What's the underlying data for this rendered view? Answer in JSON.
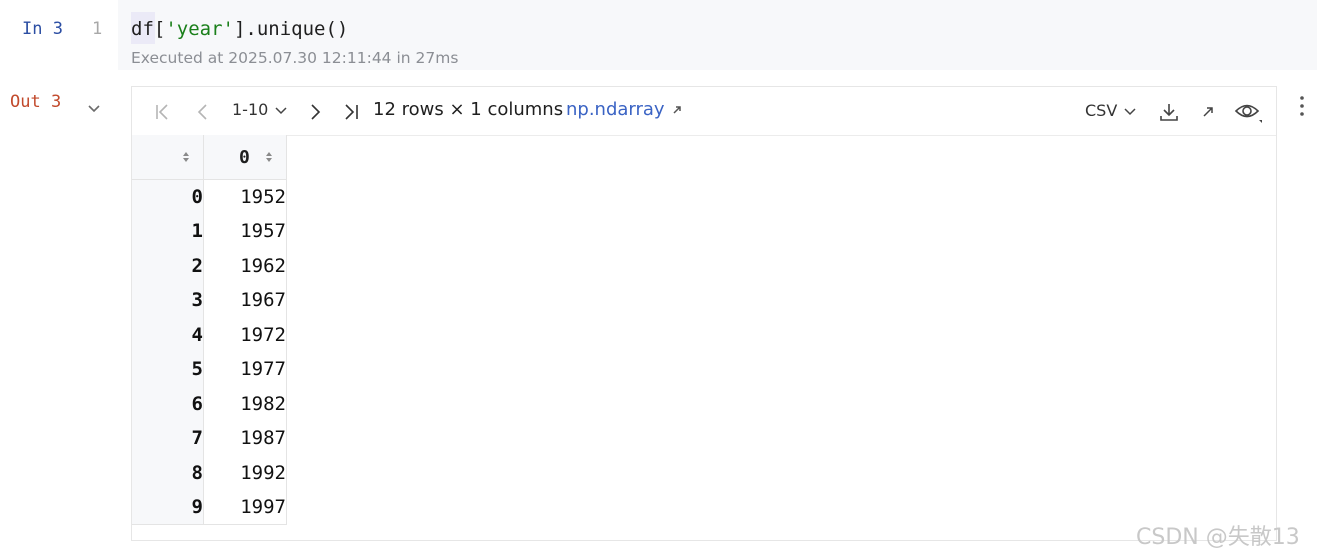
{
  "input_cell": {
    "label": "In 3",
    "line_number": "1",
    "code_prefix": "df[",
    "code_string": "'year'",
    "code_suffix": "].unique()",
    "executed_info": "Executed at 2025.07.30 12:11:44 in 27ms"
  },
  "output_cell": {
    "label": "Out 3",
    "toolbar": {
      "range": "1-10",
      "summary": "12 rows × 1 columns",
      "type_link": "np.ndarray",
      "export_format": "CSV"
    },
    "table": {
      "column_header": "0",
      "rows": [
        {
          "index": "0",
          "value": "1952"
        },
        {
          "index": "1",
          "value": "1957"
        },
        {
          "index": "2",
          "value": "1962"
        },
        {
          "index": "3",
          "value": "1967"
        },
        {
          "index": "4",
          "value": "1972"
        },
        {
          "index": "5",
          "value": "1977"
        },
        {
          "index": "6",
          "value": "1982"
        },
        {
          "index": "7",
          "value": "1987"
        },
        {
          "index": "8",
          "value": "1992"
        },
        {
          "index": "9",
          "value": "1997"
        }
      ]
    }
  },
  "watermark": "CSDN @失散13",
  "colors": {
    "in_label": "#2c4ea3",
    "out_label": "#c24a2c",
    "string_literal": "#1a7f1a",
    "link": "#3a63c4"
  },
  "icons": [
    "first-page-icon",
    "prev-page-icon",
    "chevron-down-icon",
    "next-page-icon",
    "last-page-icon",
    "external-link-icon",
    "download-icon",
    "expand-icon",
    "eye-icon",
    "more-vertical-icon",
    "sort-icon"
  ]
}
